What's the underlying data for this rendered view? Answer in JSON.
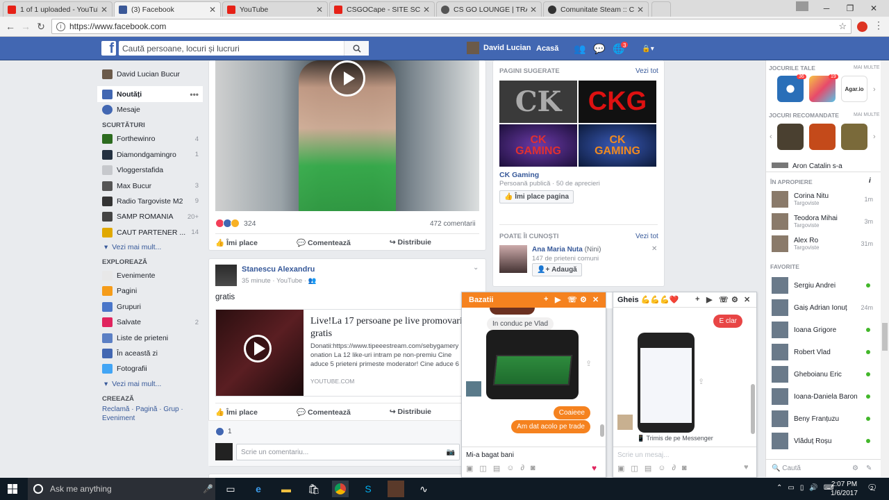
{
  "browser": {
    "tabs": [
      {
        "title": "1 of 1 uploaded - YouTube",
        "color": "#e62117"
      },
      {
        "title": "(3) Facebook",
        "color": "#3b5998"
      },
      {
        "title": "YouTube",
        "color": "#e62117"
      },
      {
        "title": "CSGOCape - SITE SCAM",
        "color": "#e62117"
      },
      {
        "title": "CS GO LOUNGE | TRADI",
        "color": "#555555"
      },
      {
        "title": "Comunitate Steam :: Cine",
        "color": "#333333"
      }
    ],
    "url": "https://www.facebook.com"
  },
  "fb_header": {
    "search_placeholder": "Caută persoane, locuri și lucruri",
    "user_name": "David Lucian",
    "home": "Acasă",
    "notif_count": "3"
  },
  "left_nav": {
    "profile": "David Lucian Bucur",
    "items": [
      {
        "label": "Noutăți",
        "color": "#4267b2"
      },
      {
        "label": "Mesaje",
        "color": "#4267b2"
      }
    ],
    "shortcuts_head": "SCURTĂTURI",
    "shortcuts": [
      {
        "label": "Forthewinro",
        "count": "4",
        "color": "#2c6b1f"
      },
      {
        "label": "Diamondgamingro",
        "count": "1",
        "color": "#233040"
      },
      {
        "label": "Vloggerstafida",
        "count": "",
        "color": "#c6c8cc"
      },
      {
        "label": "Max Bucur",
        "count": "3",
        "color": "#555555"
      },
      {
        "label": "Radio Targoviste M2",
        "count": "9",
        "color": "#333333"
      },
      {
        "label": "SAMP ROMANIA",
        "count": "20+",
        "color": "#444444"
      },
      {
        "label": "CAUT PARTENER ...",
        "count": "14",
        "color": "#e0a800"
      }
    ],
    "see_more": "Vezi mai mult...",
    "explore_head": "EXPLOREAZĂ",
    "explore": [
      {
        "label": "Evenimente",
        "count": "",
        "color": "#e8e8e8"
      },
      {
        "label": "Pagini",
        "count": "",
        "color": "#f59c1a"
      },
      {
        "label": "Grupuri",
        "count": "",
        "color": "#4a76c9"
      },
      {
        "label": "Salvate",
        "count": "2",
        "color": "#e0245e"
      },
      {
        "label": "Liste de prieteni",
        "count": "",
        "color": "#5b7fc4"
      },
      {
        "label": "În această zi",
        "count": "",
        "color": "#4267b2"
      },
      {
        "label": "Fotografii",
        "count": "",
        "color": "#42a5f5"
      }
    ],
    "create_head": "CREEAZĂ",
    "create_links": "Reclamă · Pagină · Grup · Eveniment"
  },
  "post1": {
    "reaction_count": "324",
    "comments": "472 comentarii",
    "like": "Îmi place",
    "comment": "Comentează",
    "share": "Distribuie"
  },
  "post2": {
    "author": "Stanescu Alexandru",
    "meta": "35 minute · YouTube ·",
    "text": "gratis",
    "link_title": "Live!La 17 persoane pe live promovari gratis",
    "link_desc": "Donatii:https://www.tipeeestream.com/sebygamery onation La 12 like-uri intram pe non-premiu Cine aduce 5 prieteni primeste moderator! Cine aduce 6",
    "link_domain": "YOUTUBE.COM",
    "like": "Îmi place",
    "comment": "Comentează",
    "share": "Distribuie",
    "likes": "1",
    "comment_placeholder": "Scrie un comentariu..."
  },
  "right_col": {
    "suggested_head": "PAGINI SUGERATE",
    "see_all": "Vezi tot",
    "page_name": "CK Gaming",
    "page_meta": "Persoană publică · 50 de aprecieri",
    "like_page": "Îmi place pagina",
    "pymk_head": "POATE ÎI CUNOȘTI",
    "pymk_name": "Ana Maria Nuta",
    "pymk_alias": "(Nini)",
    "pymk_mutual": "147 de prieteni comuni",
    "add": "Adaugă"
  },
  "sidebar": {
    "games_head": "JOCURILE TALE",
    "more": "MAI MULTE",
    "games": [
      {
        "name": "8",
        "badge": "36",
        "color": "#2a6fb8"
      },
      {
        "name": "",
        "badge": "19",
        "color": "#f4a623"
      },
      {
        "name": "Agar.io",
        "badge": "",
        "color": "#ffffff"
      }
    ],
    "rec_head": "JOCURI RECOMANDATE",
    "rec_games": [
      "#4a4030",
      "#c44a1a",
      "#7a6a3a"
    ],
    "ticker": "Aron Catalin s-a",
    "nearby_head": "ÎN APROPIERE",
    "nearby": [
      {
        "name": "Corina Nitu",
        "place": "Targoviste",
        "time": "1m"
      },
      {
        "name": "Teodora Mihai",
        "place": "Targoviste",
        "time": "3m"
      },
      {
        "name": "Alex Ro",
        "place": "Targoviste",
        "time": "31m"
      }
    ],
    "fav_head": "FAVORITE",
    "favorites": [
      {
        "name": "Sergiu Andrei",
        "status": "online"
      },
      {
        "name": "Gaiș Adrian Ionuț",
        "status": "24m"
      },
      {
        "name": "Ioana Grigore",
        "status": "online"
      },
      {
        "name": "Robert Vlad",
        "status": "online"
      },
      {
        "name": "Gheboianu Eric",
        "status": "online"
      },
      {
        "name": "Ioana-Daniela Baron",
        "status": "online"
      },
      {
        "name": "Beny Franțuzu",
        "status": "online"
      },
      {
        "name": "Vlăduț Roșu",
        "status": "online"
      }
    ],
    "search_placeholder": "Caută"
  },
  "chat1": {
    "name": "Bazatii",
    "header_color": "#f5821f",
    "messages": [
      "In conduc pe Vlad",
      "Coaieee",
      "Am dat acolo pe trade"
    ],
    "input": "Mi-a bagat bani"
  },
  "chat2": {
    "name": "Gheis 💪💪💪❤️",
    "reply": "E clar",
    "sent_via": "Trimis de pe Messenger",
    "input_placeholder": "Scrie un mesaj..."
  },
  "taskbar": {
    "search": "Ask me anything",
    "time": "2:07 PM",
    "date": "1/6/2017",
    "notif": "2"
  }
}
